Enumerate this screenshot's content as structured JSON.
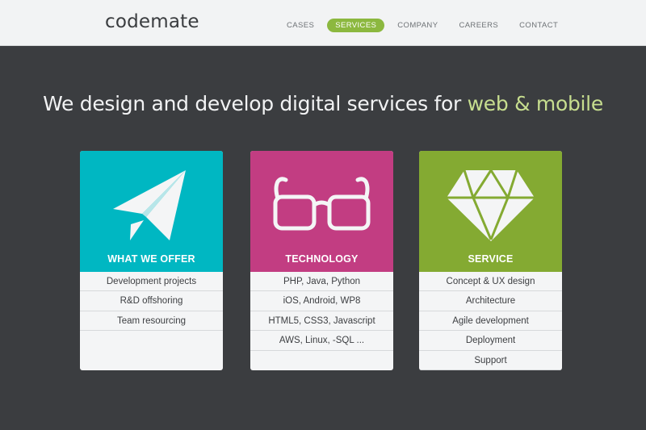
{
  "header": {
    "logo": "codemate",
    "nav": [
      "CASES",
      "SERVICES",
      "COMPANY",
      "CAREERS",
      "CONTACT"
    ],
    "active_nav": "SERVICES"
  },
  "hero": {
    "text": "We design and develop digital services for ",
    "accent_text": "web & mobile"
  },
  "cards": [
    {
      "title": "WHAT WE OFFER",
      "color": "#00b7c2",
      "icon": "paper-plane-icon",
      "items": [
        "Development projects",
        "R&D offshoring",
        "Team resourcing"
      ]
    },
    {
      "title": "TECHNOLOGY",
      "color": "#c23d82",
      "icon": "glasses-icon",
      "items": [
        "PHP, Java, Python",
        "iOS, Android, WP8",
        "HTML5, CSS3, Javascript",
        "AWS, Linux, -SQL ..."
      ]
    },
    {
      "title": "SERVICE",
      "color": "#84aa32",
      "icon": "diamond-icon",
      "items": [
        "Concept & UX design",
        "Architecture",
        "Agile development",
        "Deployment",
        "Support"
      ]
    }
  ],
  "colors": {
    "background": "#3b3d40",
    "topbar": "#f2f3f4",
    "accent_green": "#8cb83f",
    "hero_accent": "#c7de8f"
  }
}
